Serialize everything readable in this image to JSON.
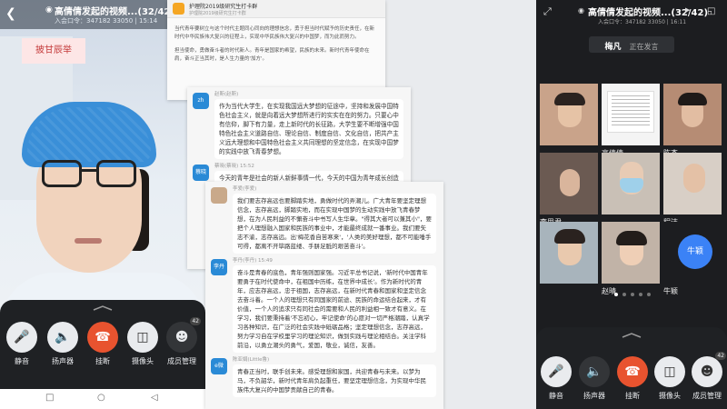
{
  "left_phone": {
    "title": "高倩倩发起的视频...(32/42)",
    "subtitle": "入会口令：347182 33050 | 15:14",
    "banner": "披甘辰举",
    "controls": {
      "mute": "静音",
      "speaker": "扬声器",
      "hangup": "挂断",
      "camera": "摄像头",
      "members": "成员管理",
      "member_count": "42"
    }
  },
  "chat_a": {
    "group_name": "护理院2019级研究生打卡群",
    "meta": "护理院2019级研究生打卡群",
    "paragraphs": [
      "当代青年要树立与这个时代主题同心同向的理想信念，勇于担当时代赋予的历史责任，在新时代中华民族伟大复兴的征程上，实现中华民族伟大复兴的中国梦，而为此而努力。",
      "担当使命，勇做奋斗者的时代新人。青年是国家的希望，民族的未来。新时代青年使命在肩，奋斗正当其时，是人生力量的'加方'。"
    ]
  },
  "chat_b": {
    "messages": [
      {
        "avatar": "zh",
        "sender": "赵斯(赵斯)",
        "text": "作为当代大学生，在实现我国远大梦想的征途中，坚持和发展中国特色社会主义，就是向着远大梦想所进行的实实在在的努力。只要心中有信仰，脚下有力量，走上新时代的长征路，大学生要不断增强中国特色社会主义道路自信、理论自信、制度自信、文化自信，把共产主义远大理想和中国特色社会主义共同理想的坚定信念，在实现中国梦的实践中放飞青春梦想。"
      },
      {
        "avatar": "蔡晓",
        "sender": "蔡晓(蔡晓) 15:52",
        "text": "今天的青年是社会的新人新鲜事情一代，今天的中国为青年成长创造了良好条件，而这也要求新青年一代青要青负担当担当，广大青年要勇敢肩负起时代赋予的重任，志存高远，脚踏实地，努力实现中华民族伟大复兴的中国梦而奋斗。"
      }
    ]
  },
  "chat_c": {
    "messages": [
      {
        "avatar": "",
        "sender": "李爱(李爱)",
        "text": "我们要志存高远也要脚踏实地，勇做时代的弄潮儿。广大青年要坚定理想信念，志存高远，脚踏实地，而在实现中国梦的生动实践中放飞青春梦想，在为人民利益的不懈奋斗中书写人生华章。\"得其大者可以兼其小\"，要把个人理想融入国家和民族的事业中，才能最终成就一番事业。我们要矢志不渝，志存高远。出'梅花香自苦寒来'，'人类的美好理想，都不可能唾手可得，都离不开筚路蓝缕、手胼足胝的艰苦奋斗'。"
      },
      {
        "avatar": "李丹",
        "sender": "李丹(李丹)  15:49",
        "text": "奋斗是青春的底色，青年强则国家强。习近平总书记说，'新时代中国青年要勇于在时代使命中，在祖国中历练，在世界中成长'。作为新时代的青年，应志存高远，忠于祖国，志存高远，在新时代青春和国家和坚定信念去奋斗着。一个人的理想只有同国家的前途、民族的命运结合起来，才有价值，一个人的追求只有同社会的需要和人民的利益相一致才有意义。在学习，我们要秉持着'不忘初心，牢记使命'的心愿对一切严格潮踏，认真学习各种知识，在广泛的社会实践中砥砺品格；坚定理想信念，志存高远，努力学习自在学校里学习的理论知识，做到实践与理论相结合。关注学科前沿，以勇立潮头的勇气，爱国，敬业，诚信，友善。"
      },
      {
        "avatar": "e微",
        "sender": "陈亚娟(Little鲁)",
        "text": "青春正当时，联手创未来。感受理想和家国，共迎青春与未来。以梦为马，不负韶华，新时代青年肩负起重任，要坚定理想信念，为实现中华民族伟大复兴的中国梦贡献自己的青春。"
      }
    ]
  },
  "right_phone": {
    "title": "高倩倩发起的视频...(32/42)",
    "subtitle": "入会口令：347182 33050 | 16:11",
    "speaking_name": "梅凡",
    "speaking_status": "正在发言",
    "tiles": [
      {
        "name": ""
      },
      {
        "name": "高倩倩"
      },
      {
        "name": "陈杰"
      },
      {
        "name": "李思君"
      },
      {
        "name": ""
      },
      {
        "name": "程洁"
      },
      {
        "name": ""
      },
      {
        "name": "赵晴"
      },
      {
        "name": "牛颖"
      }
    ],
    "avatar_initial": "牛颖",
    "controls": {
      "mute": "静音",
      "speaker": "扬声器",
      "hangup": "挂断",
      "camera": "摄像头",
      "members": "成员管理",
      "member_count": "42"
    }
  },
  "colors": {
    "hangup": "#e8532f",
    "control_bar": "#1f2124",
    "avatar_blue": "#3b82f6",
    "chat_avatar": "#2a8ad6"
  }
}
